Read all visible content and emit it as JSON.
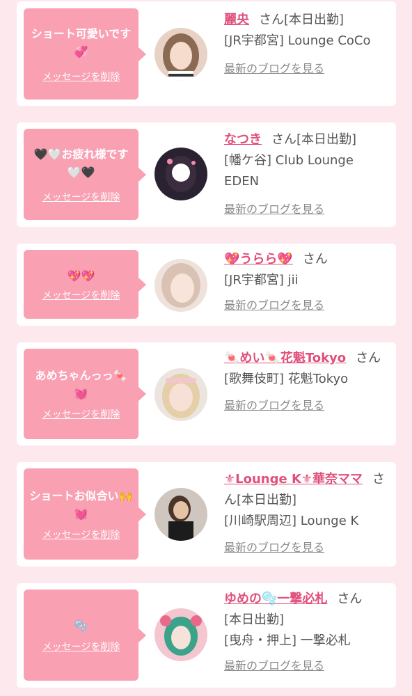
{
  "cards": [
    {
      "message": "ショート可愛いです💞",
      "delete_label": "メッセージを削除",
      "name": "麗央",
      "suffix": "さん[本日出勤]",
      "shop": "[JR宇都宮] Lounge CoCo",
      "blog_label": "最新のブログを見る"
    },
    {
      "message": "🖤🤍お疲れ様です🤍🖤",
      "delete_label": "メッセージを削除",
      "name": "なつき",
      "suffix": "さん[本日出勤]",
      "shop": "[幡ケ谷] Club Lounge EDEN",
      "blog_label": "最新のブログを見る"
    },
    {
      "message": "💖💖",
      "delete_label": "メッセージを削除",
      "name": "💖うらら💖",
      "suffix": "さん",
      "shop": "[JR宇都宮] jii",
      "blog_label": "最新のブログを見る"
    },
    {
      "message": "あめちゃんっっ🍬💓",
      "delete_label": "メッセージを削除",
      "name": "🍬めい🍬花魁Tokyo",
      "suffix": "さん",
      "shop": "[歌舞伎町] 花魁Tokyo",
      "blog_label": "最新のブログを見る"
    },
    {
      "message": "ショートお似合い🙌💓",
      "delete_label": "メッセージを削除",
      "name": "⚜Lounge K⚜華奈ママ",
      "suffix": "さん[本日出勤]",
      "shop": "[川崎駅周辺] Lounge K",
      "blog_label": "最新のブログを見る"
    },
    {
      "message": "🫧",
      "delete_label": "メッセージを削除",
      "name": "ゆめの🫧一撃必札",
      "suffix": "さん",
      "status": "[本日出勤]",
      "shop": "[曳舟・押上] 一撃必札",
      "blog_label": "最新のブログを見る"
    }
  ]
}
